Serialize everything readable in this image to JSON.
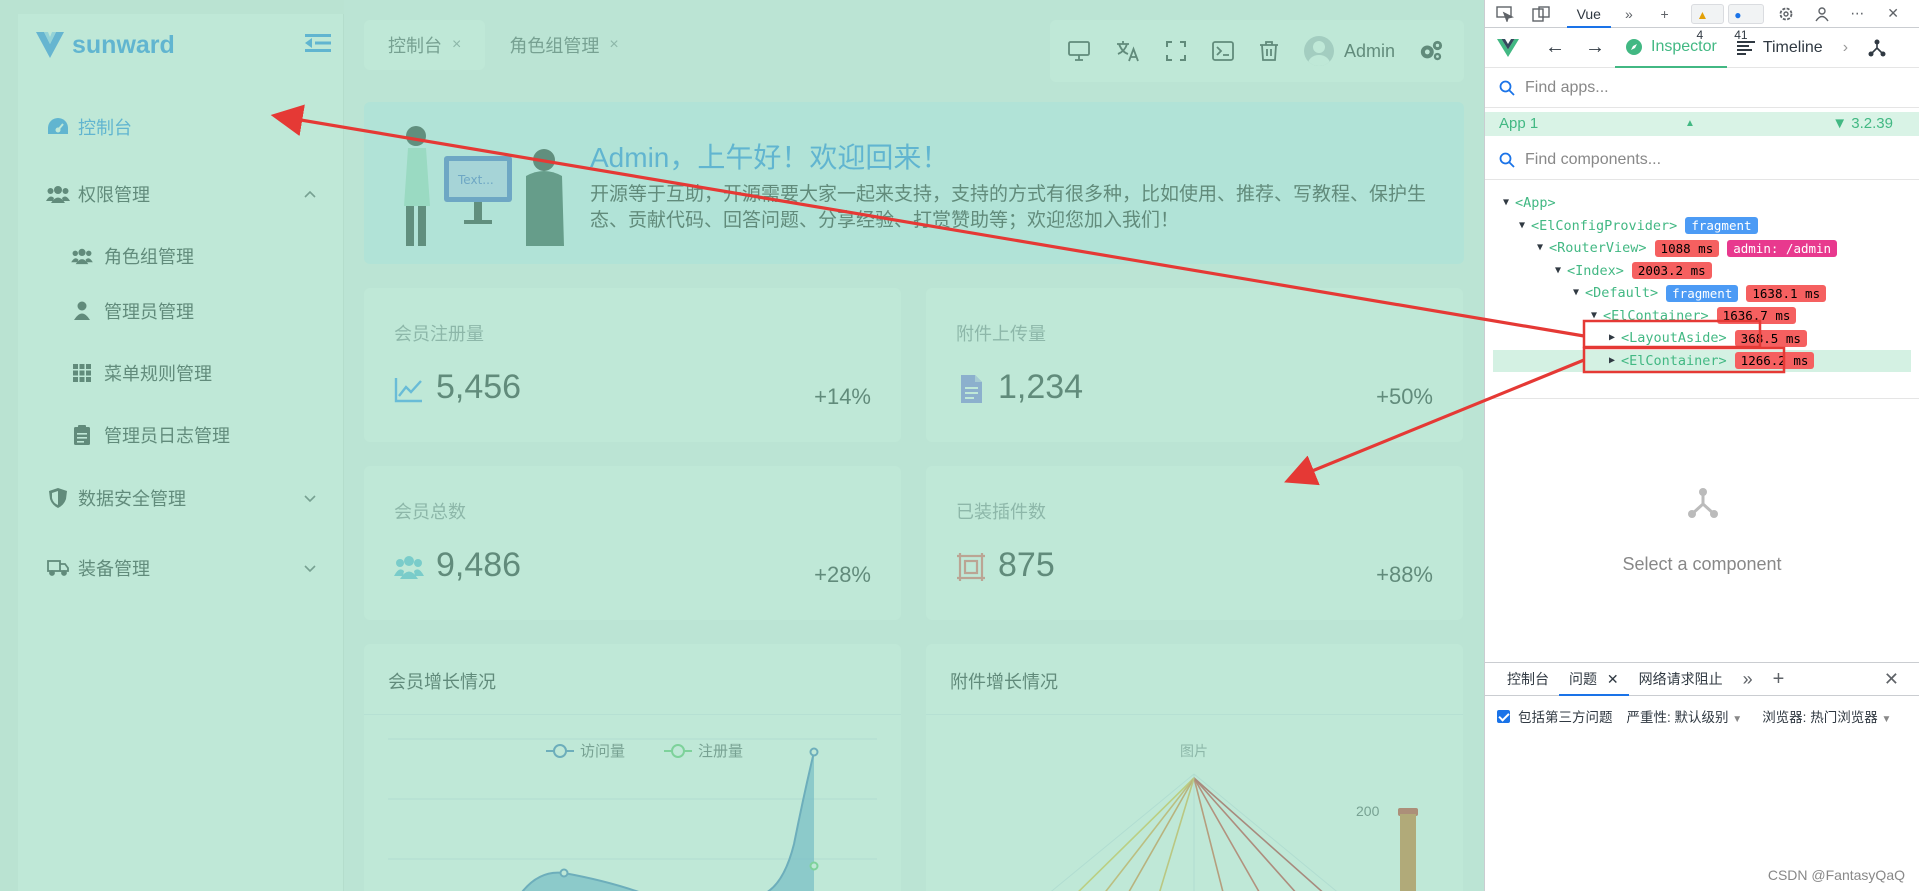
{
  "sidebar": {
    "brand": "sunward",
    "items": [
      {
        "label": "控制台"
      },
      {
        "label": "权限管理"
      },
      {
        "label": "角色组管理"
      },
      {
        "label": "管理员管理"
      },
      {
        "label": "菜单规则管理"
      },
      {
        "label": "管理员日志管理"
      },
      {
        "label": "数据安全管理"
      },
      {
        "label": "装备管理"
      }
    ]
  },
  "tabs": [
    {
      "label": "控制台",
      "close": "×"
    },
    {
      "label": "角色组管理",
      "close": "×"
    }
  ],
  "toolbar": {
    "user": "Admin"
  },
  "welcome": {
    "title": "Admin，上午好！欢迎回来！",
    "text": "开源等于互助，开源需要大家一起来支持，支持的方式有很多种，比如使用、推荐、写教程、保护生态、贡献代码、回答问题、分享经验、打赏赞助等；欢迎您加入我们！",
    "illustration_text": "Text..."
  },
  "stats": [
    {
      "label": "会员注册量",
      "value": "5,456",
      "change": "+14%",
      "icon": "line-chart-icon",
      "color": "#409eff"
    },
    {
      "label": "附件上传量",
      "value": "1,234",
      "change": "+50%",
      "icon": "file-icon",
      "color": "#8e84e8"
    },
    {
      "label": "会员总数",
      "value": "9,486",
      "change": "+28%",
      "icon": "users-icon",
      "color": "#67c2e3"
    },
    {
      "label": "已装插件数",
      "value": "875",
      "change": "+88%",
      "icon": "plugin-icon",
      "color": "#f56c6c"
    }
  ],
  "charts": [
    {
      "title": "会员增长情况",
      "legend": [
        "访问量",
        "注册量"
      ]
    },
    {
      "title": "附件增长情况",
      "legend_title": "图片",
      "axis_value": "200"
    }
  ],
  "devtools": {
    "top_tab": "Vue",
    "warnings": "4",
    "messages": "41",
    "inspector": "Inspector",
    "timeline": "Timeline",
    "find_apps": "Find apps...",
    "app_name": "App 1",
    "app_version": "3.2.39",
    "find_components": "Find components...",
    "tree": [
      {
        "tag": "<App>"
      },
      {
        "tag": "<ElConfigProvider>",
        "pills": [
          "fragment"
        ]
      },
      {
        "tag": "<RouterView>",
        "pills": [
          "1088 ms",
          "admin: /admin"
        ]
      },
      {
        "tag": "<Index>",
        "pills": [
          "2003.2 ms"
        ]
      },
      {
        "tag": "<Default>",
        "pills": [
          "fragment",
          "1638.1 ms"
        ]
      },
      {
        "tag": "<ElContainer>",
        "pills": [
          "1636.7 ms"
        ]
      },
      {
        "tag": "<LayoutAside>",
        "pills": [
          "368.5 ms"
        ]
      },
      {
        "tag": "<ElContainer>",
        "pills": [
          "1266.2 ms"
        ]
      }
    ],
    "select_hint": "Select a component",
    "bottom_tabs": [
      "控制台",
      "问题",
      "网络请求阻止"
    ],
    "filter_third_party": "包括第三方问题",
    "filter_severity": "严重性: 默认级别",
    "filter_browser": "浏览器:  热门浏览器"
  },
  "watermark": "CSDN @FantasyQaQ"
}
